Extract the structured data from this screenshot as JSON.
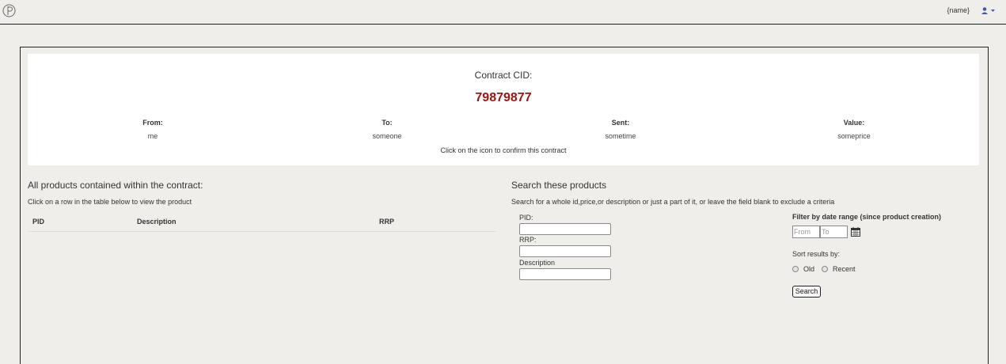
{
  "header": {
    "username": "{name}",
    "logo_icon": "logo-icon",
    "user_icon": "user-icon"
  },
  "contract": {
    "cid_label": "Contract CID:",
    "cid_value": "79879877",
    "accent_color": "#a01414",
    "fields": [
      {
        "label": "From:",
        "value": "me"
      },
      {
        "label": "To:",
        "value": "someone"
      },
      {
        "label": "Sent:",
        "value": "sometime"
      },
      {
        "label": "Value:",
        "value": "someprice"
      }
    ],
    "confirm_note": "Click on the icon to confirm this contract"
  },
  "products": {
    "title": "All products contained within the contract:",
    "subtitle": "Click on a row in the table below to view the product",
    "columns": [
      "PID",
      "Description",
      "RRP"
    ]
  },
  "search": {
    "title": "Search these products",
    "subtitle": "Search for a whole id,price,or description or just a part of it, or leave the field blank to exclude a criteria",
    "pid_label": "PID:",
    "rrp_label": "RRP:",
    "description_label": "Description",
    "pid_value": "",
    "rrp_value": "",
    "description_value": "",
    "filter_title": "Filter by date range (since product creation)",
    "from_placeholder": "From",
    "to_placeholder": "To",
    "calendar_icon": "calendar-icon",
    "sort_title": "Sort results by:",
    "sort_options": [
      "Old",
      "Recent"
    ],
    "button_label": "Search"
  }
}
